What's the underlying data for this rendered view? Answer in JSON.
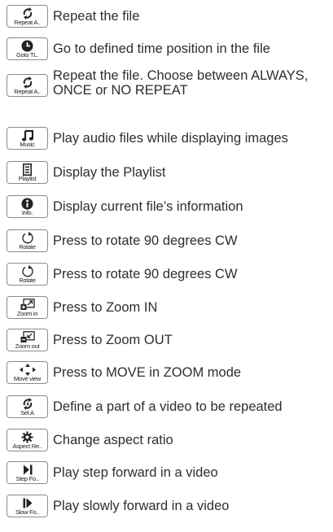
{
  "items": [
    {
      "icon": "repeat-icon",
      "button": "Repeat A..",
      "text": "Repeat the file"
    },
    {
      "icon": "clock-icon",
      "button": "Goto TL.",
      "text": "Go to defined time position in the file"
    },
    {
      "icon": "repeat-icon",
      "button": "Repeat A..",
      "text": "Repeat the file. Choose between ALWAYS, ONCE or NO REPEAT"
    },
    {
      "icon": "music-note-icon",
      "button": "Music",
      "text": "Play audio files while displaying images"
    },
    {
      "icon": "playlist-icon",
      "button": "Playlist",
      "text": "Display the Playlist"
    },
    {
      "icon": "info-icon",
      "button": "Info.",
      "text": "Display current file’s information"
    },
    {
      "icon": "rotate-cw-icon",
      "button": "Rotate",
      "text": "Press to rotate 90 degrees CW"
    },
    {
      "icon": "rotate-cw-icon",
      "button": "Rotate",
      "text": "Press to rotate 90 degrees CW"
    },
    {
      "icon": "zoom-in-icon",
      "button": "Zoom in",
      "text": "Press to Zoom IN"
    },
    {
      "icon": "zoom-out-icon",
      "button": "Zoom out",
      "text": "Press to Zoom OUT"
    },
    {
      "icon": "move-arrows-icon",
      "button": "Move view",
      "text": "Press to MOVE in ZOOM mode"
    },
    {
      "icon": "set-a-icon",
      "button": "Set A",
      "text": "Define a part of a video to be repeated"
    },
    {
      "icon": "aspect-gear-icon",
      "button": "Aspect Re..",
      "text": "Change aspect ratio"
    },
    {
      "icon": "step-forward-icon",
      "button": "Step Fo..",
      "text": "Play step forward in a video"
    },
    {
      "icon": "slow-forward-icon",
      "button": "Slow Fo..",
      "text": "Play slowly forward in a video"
    }
  ]
}
